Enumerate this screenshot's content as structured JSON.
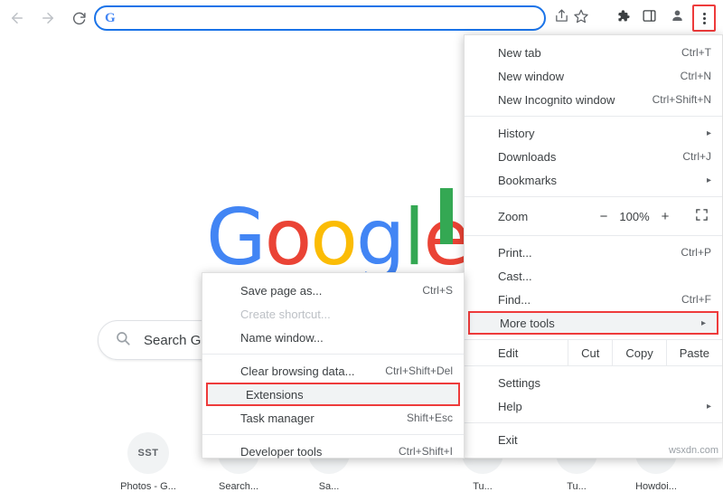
{
  "toolbar": {
    "back_icon": "arrow-left-icon",
    "forward_icon": "arrow-right-icon",
    "reload_icon": "reload-icon",
    "omnibox": {
      "value": "",
      "placeholder": "",
      "leading_icon": "google-g-icon",
      "leading_glyph": "G"
    },
    "share_icon": "share-icon",
    "star_icon": "star-icon",
    "extensions_icon": "puzzle-piece-icon",
    "sidepanel_icon": "side-panel-icon",
    "profile_icon": "profile-avatar-icon",
    "menu_icon": "three-dot-menu-icon"
  },
  "page": {
    "logo_letters": [
      "G",
      "o",
      "o",
      "g",
      "l",
      "e"
    ],
    "search": {
      "placeholder": "Search G",
      "icon": "magnifier-icon"
    },
    "shortcuts": [
      {
        "tile": "SST",
        "label": "Photos - G..."
      },
      {
        "tile": "",
        "label": "Search..."
      },
      {
        "tile": "",
        "label": "Sa..."
      },
      {
        "tile": "",
        "label": ""
      },
      {
        "tile": "",
        "label": "Tu..."
      },
      {
        "tile": "",
        "label": "Tu..."
      },
      {
        "tile": "",
        "label": "Howdoi..."
      }
    ]
  },
  "main_menu": {
    "items": [
      {
        "label": "New tab",
        "accel": "Ctrl+T",
        "arrow": false
      },
      {
        "label": "New window",
        "accel": "Ctrl+N",
        "arrow": false
      },
      {
        "label": "New Incognito window",
        "accel": "Ctrl+Shift+N",
        "arrow": false
      },
      {
        "label": "History",
        "accel": "",
        "arrow": true
      },
      {
        "label": "Downloads",
        "accel": "Ctrl+J",
        "arrow": false
      },
      {
        "label": "Bookmarks",
        "accel": "",
        "arrow": true
      }
    ],
    "zoom": {
      "label": "Zoom",
      "minus": "−",
      "value": "100%",
      "plus": "+",
      "fullscreen_icon": "fullscreen-icon"
    },
    "items2": [
      {
        "label": "Print...",
        "accel": "Ctrl+P",
        "arrow": false
      },
      {
        "label": "Cast...",
        "accel": "",
        "arrow": false
      },
      {
        "label": "Find...",
        "accel": "Ctrl+F",
        "arrow": false
      },
      {
        "label": "More tools",
        "accel": "",
        "arrow": true
      }
    ],
    "edit_row": {
      "title": "Edit",
      "cut": "Cut",
      "copy": "Copy",
      "paste": "Paste"
    },
    "items3": [
      {
        "label": "Settings",
        "accel": "",
        "arrow": false
      },
      {
        "label": "Help",
        "accel": "",
        "arrow": true
      }
    ],
    "items4": [
      {
        "label": "Exit",
        "accel": "",
        "arrow": false
      }
    ],
    "highlight_color": "#ee3b3b"
  },
  "submenu": {
    "items": [
      {
        "label": "Save page as...",
        "accel": "Ctrl+S",
        "dim": false
      },
      {
        "label": "Create shortcut...",
        "accel": "",
        "dim": true
      },
      {
        "label": "Name window...",
        "accel": "",
        "dim": false
      }
    ],
    "items2": [
      {
        "label": "Clear browsing data...",
        "accel": "Ctrl+Shift+Del",
        "dim": false
      },
      {
        "label": "Extensions",
        "accel": "",
        "dim": false
      },
      {
        "label": "Task manager",
        "accel": "Shift+Esc",
        "dim": false
      }
    ],
    "items3": [
      {
        "label": "Developer tools",
        "accel": "Ctrl+Shift+I",
        "dim": false
      }
    ]
  },
  "watermark": "wsxdn.com"
}
